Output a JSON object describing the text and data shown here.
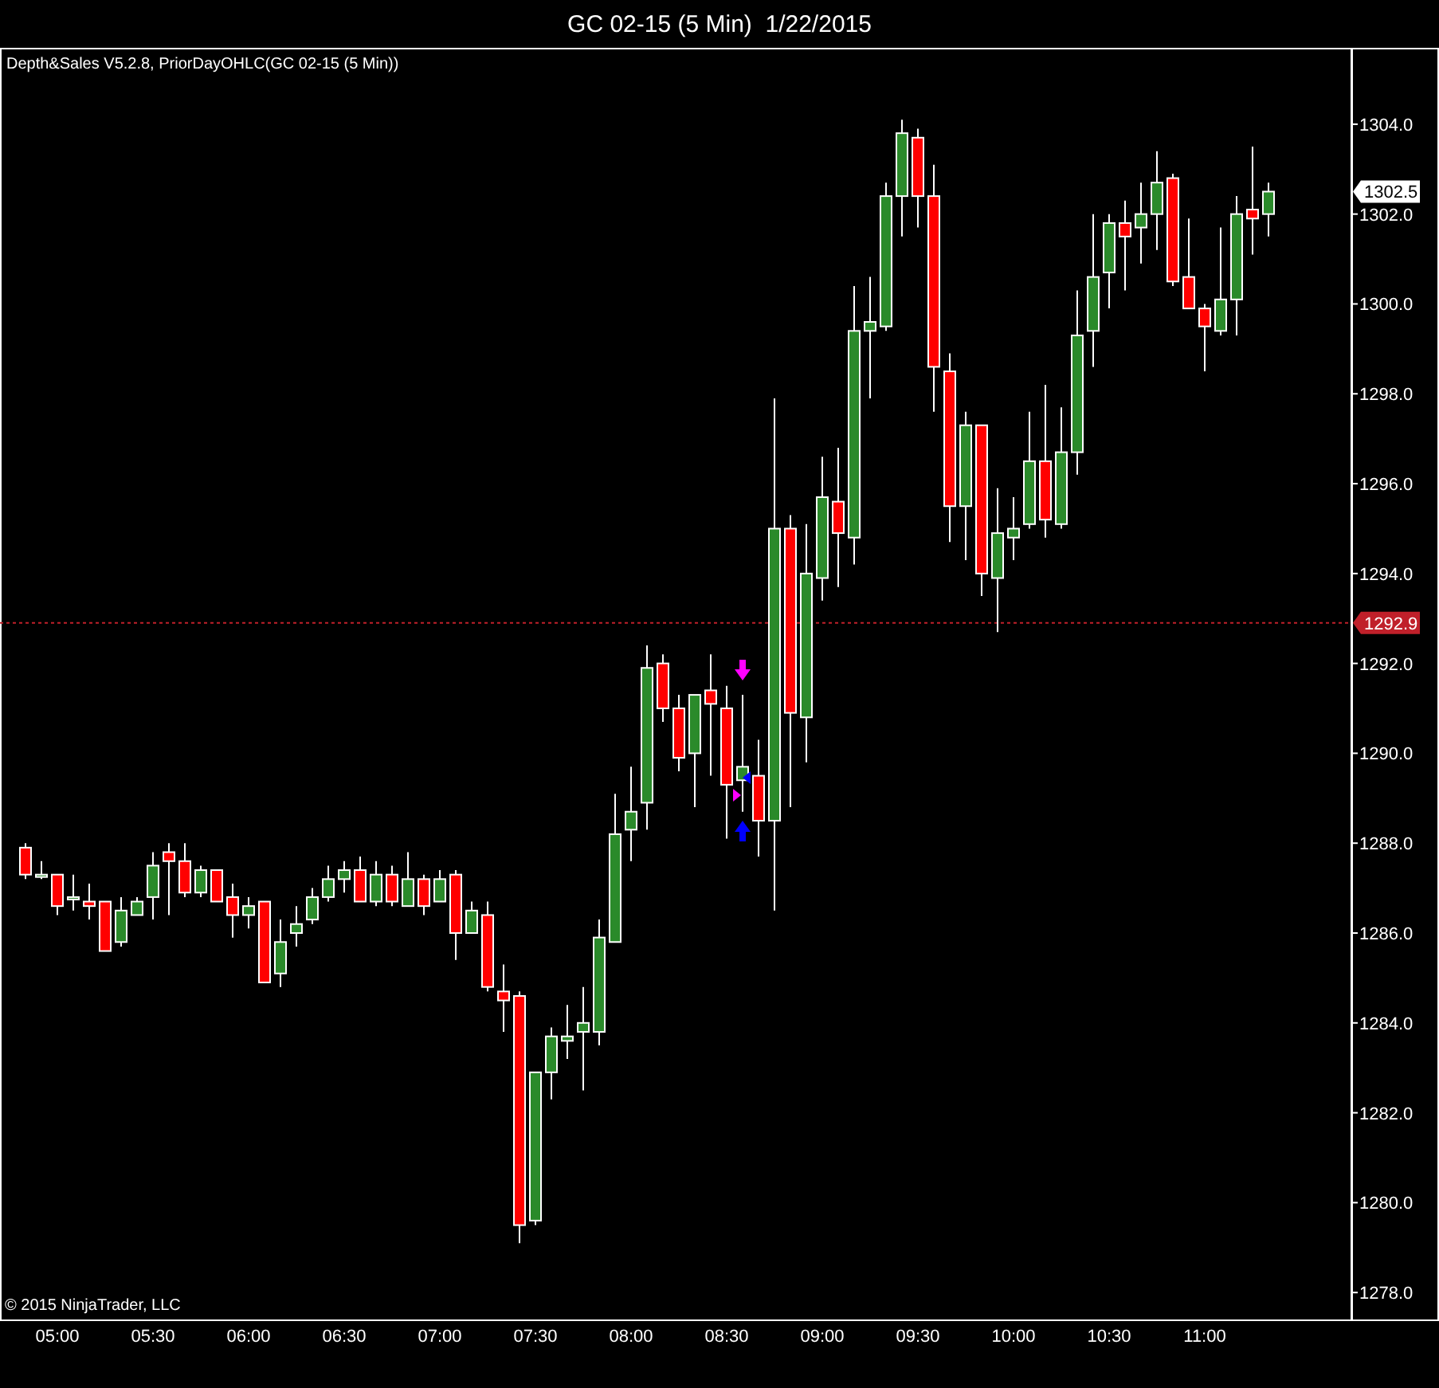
{
  "window": {
    "title": "GC 02-15 (5 Min)  1/22/2015"
  },
  "chart": {
    "indicator_label": "Depth&Sales V5.2.8, PriorDayOHLC(GC 02-15 (5 Min))",
    "copyright": "© 2015 NinjaTrader, LLC",
    "chart_data": {
      "type": "candlestick",
      "xlim": [
        282,
        706
      ],
      "ylim": [
        1277.4,
        1305.7
      ],
      "x": [
        290,
        295,
        300,
        305,
        310,
        315,
        320,
        325,
        330,
        335,
        340,
        345,
        350,
        355,
        360,
        365,
        370,
        375,
        380,
        385,
        390,
        395,
        400,
        405,
        410,
        415,
        420,
        425,
        430,
        435,
        440,
        445,
        450,
        455,
        460,
        465,
        470,
        475,
        480,
        485,
        490,
        495,
        500,
        505,
        510,
        515,
        520,
        525,
        530,
        535,
        540,
        545,
        550,
        555,
        560,
        565,
        570,
        575,
        580,
        585,
        590,
        595,
        600,
        605,
        610,
        615,
        620,
        625,
        630,
        635,
        640,
        645,
        650,
        655,
        660,
        665,
        670,
        675,
        680
      ],
      "ohlc": [
        [
          1287.9,
          1288.0,
          1287.2,
          1287.3
        ],
        [
          1287.3,
          1287.6,
          1287.2,
          1287.3
        ],
        [
          1287.3,
          1287.3,
          1286.4,
          1286.6
        ],
        [
          1286.8,
          1287.3,
          1286.5,
          1286.8
        ],
        [
          1286.7,
          1287.1,
          1286.3,
          1286.6
        ],
        [
          1286.7,
          1286.7,
          1285.6,
          1285.6
        ],
        [
          1285.8,
          1286.8,
          1285.7,
          1286.5
        ],
        [
          1286.4,
          1286.8,
          1286.4,
          1286.7
        ],
        [
          1286.8,
          1287.8,
          1286.3,
          1287.5
        ],
        [
          1287.8,
          1288.0,
          1286.4,
          1287.6
        ],
        [
          1287.6,
          1288.0,
          1286.8,
          1286.9
        ],
        [
          1286.9,
          1287.5,
          1286.8,
          1287.4
        ],
        [
          1287.4,
          1287.4,
          1286.7,
          1286.7
        ],
        [
          1286.8,
          1287.1,
          1285.9,
          1286.4
        ],
        [
          1286.4,
          1286.8,
          1286.1,
          1286.6
        ],
        [
          1286.7,
          1286.7,
          1284.9,
          1284.9
        ],
        [
          1285.1,
          1286.3,
          1284.8,
          1285.8
        ],
        [
          1286.0,
          1286.6,
          1285.7,
          1286.2
        ],
        [
          1286.3,
          1287.0,
          1286.2,
          1286.8
        ],
        [
          1286.8,
          1287.5,
          1286.7,
          1287.2
        ],
        [
          1287.2,
          1287.6,
          1286.9,
          1287.4
        ],
        [
          1287.4,
          1287.7,
          1286.7,
          1286.7
        ],
        [
          1286.7,
          1287.6,
          1286.6,
          1287.3
        ],
        [
          1287.3,
          1287.5,
          1286.6,
          1286.7
        ],
        [
          1286.6,
          1287.8,
          1286.6,
          1287.2
        ],
        [
          1287.2,
          1287.3,
          1286.4,
          1286.6
        ],
        [
          1286.7,
          1287.4,
          1286.7,
          1287.2
        ],
        [
          1287.3,
          1287.4,
          1285.4,
          1286.0
        ],
        [
          1286.0,
          1286.7,
          1286.0,
          1286.5
        ],
        [
          1286.4,
          1286.7,
          1284.7,
          1284.8
        ],
        [
          1284.7,
          1285.3,
          1283.8,
          1284.5
        ],
        [
          1284.6,
          1284.7,
          1279.1,
          1279.5
        ],
        [
          1279.6,
          1282.9,
          1279.5,
          1282.9
        ],
        [
          1282.9,
          1283.9,
          1282.3,
          1283.7
        ],
        [
          1283.6,
          1284.4,
          1283.2,
          1283.7
        ],
        [
          1283.8,
          1284.8,
          1282.5,
          1284.0
        ],
        [
          1283.8,
          1286.3,
          1283.5,
          1285.9
        ],
        [
          1285.8,
          1289.1,
          1285.8,
          1288.2
        ],
        [
          1288.3,
          1289.7,
          1287.6,
          1288.7
        ],
        [
          1288.9,
          1292.4,
          1288.3,
          1291.9
        ],
        [
          1292.0,
          1292.2,
          1290.7,
          1291.0
        ],
        [
          1291.0,
          1291.3,
          1289.6,
          1289.9
        ],
        [
          1290.0,
          1291.3,
          1288.8,
          1291.3
        ],
        [
          1291.4,
          1292.2,
          1289.5,
          1291.1
        ],
        [
          1291.0,
          1291.5,
          1288.1,
          1289.3
        ],
        [
          1289.4,
          1291.3,
          1288.7,
          1289.7
        ],
        [
          1289.5,
          1290.3,
          1287.7,
          1288.5
        ],
        [
          1288.5,
          1297.9,
          1286.5,
          1295.0
        ],
        [
          1295.0,
          1295.3,
          1288.8,
          1290.9
        ],
        [
          1290.8,
          1295.1,
          1289.8,
          1294.0
        ],
        [
          1293.9,
          1296.6,
          1293.4,
          1295.7
        ],
        [
          1295.6,
          1296.8,
          1293.7,
          1294.9
        ],
        [
          1294.8,
          1300.4,
          1294.2,
          1299.4
        ],
        [
          1299.4,
          1300.6,
          1297.9,
          1299.6
        ],
        [
          1299.5,
          1302.7,
          1299.4,
          1302.4
        ],
        [
          1302.4,
          1304.1,
          1301.5,
          1303.8
        ],
        [
          1303.7,
          1303.9,
          1301.7,
          1302.4
        ],
        [
          1302.4,
          1303.1,
          1297.6,
          1298.6
        ],
        [
          1298.5,
          1298.9,
          1294.7,
          1295.5
        ],
        [
          1295.5,
          1297.6,
          1294.3,
          1297.3
        ],
        [
          1297.3,
          1297.3,
          1293.5,
          1294.0
        ],
        [
          1293.9,
          1295.9,
          1292.7,
          1294.9
        ],
        [
          1294.8,
          1295.7,
          1294.3,
          1295.0
        ],
        [
          1295.1,
          1297.6,
          1295.0,
          1296.5
        ],
        [
          1296.5,
          1298.2,
          1294.8,
          1295.2
        ],
        [
          1295.1,
          1297.7,
          1295.0,
          1296.7
        ],
        [
          1296.7,
          1300.3,
          1296.2,
          1299.3
        ],
        [
          1299.4,
          1302.0,
          1298.6,
          1300.6
        ],
        [
          1300.7,
          1302.0,
          1299.9,
          1301.8
        ],
        [
          1301.8,
          1302.3,
          1300.3,
          1301.5
        ],
        [
          1301.7,
          1302.7,
          1300.9,
          1302.0
        ],
        [
          1302.0,
          1303.4,
          1301.2,
          1302.7
        ],
        [
          1302.8,
          1302.9,
          1300.4,
          1300.5
        ],
        [
          1300.6,
          1301.9,
          1299.9,
          1299.9
        ],
        [
          1299.9,
          1300.0,
          1298.5,
          1299.5
        ],
        [
          1299.4,
          1301.7,
          1299.3,
          1300.1
        ],
        [
          1300.1,
          1302.4,
          1299.3,
          1302.0
        ],
        [
          1302.1,
          1303.5,
          1301.1,
          1301.9
        ],
        [
          1302.0,
          1302.7,
          1301.5,
          1302.5
        ]
      ],
      "yticks": [
        {
          "value": 1278,
          "label": "1278.0"
        },
        {
          "value": 1280,
          "label": "1280.0"
        },
        {
          "value": 1282,
          "label": "1282.0"
        },
        {
          "value": 1284,
          "label": "1284.0"
        },
        {
          "value": 1286,
          "label": "1286.0"
        },
        {
          "value": 1288,
          "label": "1288.0"
        },
        {
          "value": 1290,
          "label": "1290.0"
        },
        {
          "value": 1292,
          "label": "1292.0"
        },
        {
          "value": 1294,
          "label": "1294.0"
        },
        {
          "value": 1296,
          "label": "1296.0"
        },
        {
          "value": 1298,
          "label": "1298.0"
        },
        {
          "value": 1300,
          "label": "1300.0"
        },
        {
          "value": 1302,
          "label": "1302.0"
        },
        {
          "value": 1304,
          "label": "1304.0"
        }
      ],
      "xticks": [
        {
          "value": 300,
          "label": "05:00"
        },
        {
          "value": 330,
          "label": "05:30"
        },
        {
          "value": 360,
          "label": "06:00"
        },
        {
          "value": 390,
          "label": "06:30"
        },
        {
          "value": 420,
          "label": "07:00"
        },
        {
          "value": 450,
          "label": "07:30"
        },
        {
          "value": 480,
          "label": "08:00"
        },
        {
          "value": 510,
          "label": "08:30"
        },
        {
          "value": 540,
          "label": "09:00"
        },
        {
          "value": 570,
          "label": "09:30"
        },
        {
          "value": 600,
          "label": "10:00"
        },
        {
          "value": 630,
          "label": "10:30"
        },
        {
          "value": 660,
          "label": "11:00"
        }
      ],
      "ref_lines": [
        {
          "axis": "y",
          "value": 1292.9,
          "label": "1292.9",
          "color": "#c0202a"
        }
      ],
      "annotations": [
        "1302.5"
      ]
    }
  }
}
